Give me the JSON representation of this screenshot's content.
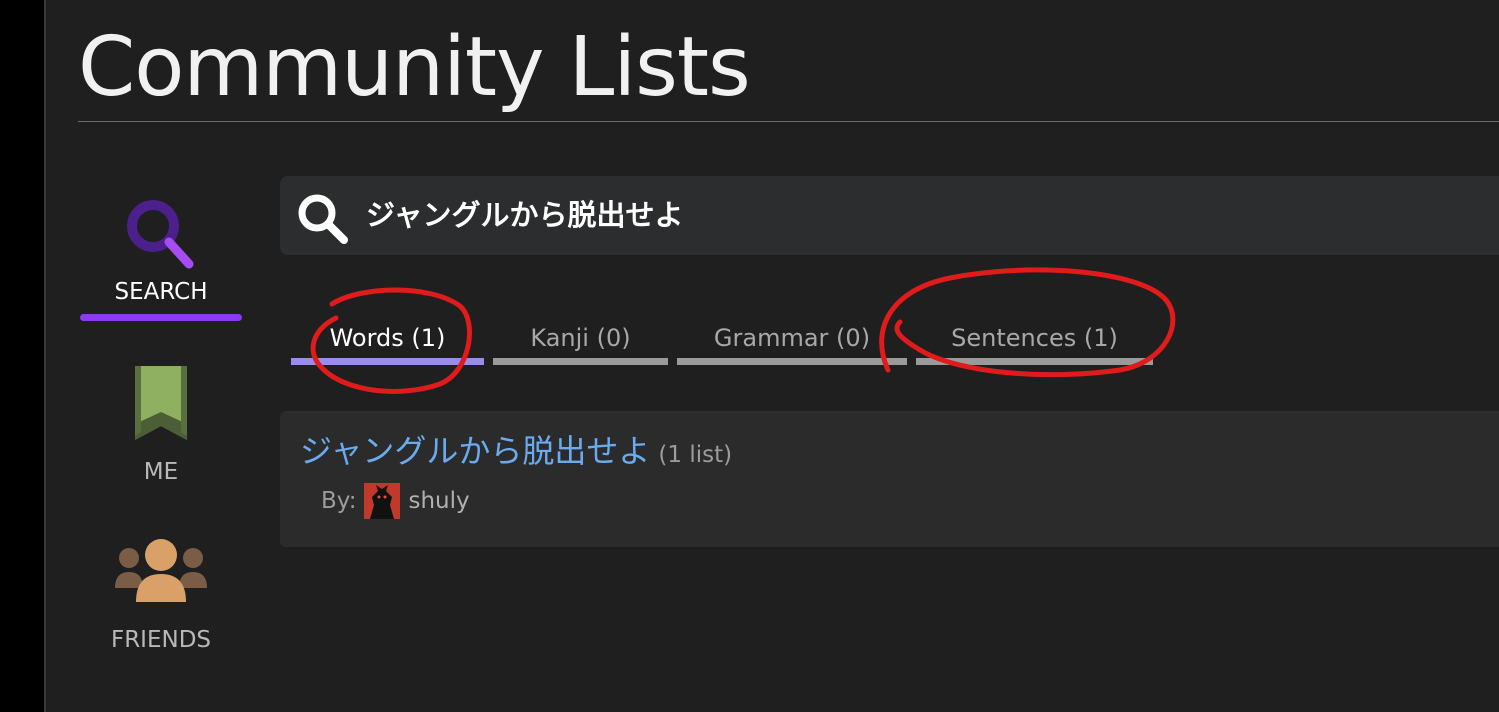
{
  "page": {
    "title": "Community Lists"
  },
  "nav": {
    "search_label": "SEARCH",
    "me_label": "ME",
    "friends_label": "FRIENDS"
  },
  "search": {
    "query": "ジャングルから脱出せよ"
  },
  "tabs": [
    {
      "label": "Words (1)",
      "active": true
    },
    {
      "label": "Kanji (0)",
      "active": false
    },
    {
      "label": "Grammar (0)",
      "active": false
    },
    {
      "label": "Sentences (1)",
      "active": false
    }
  ],
  "results": [
    {
      "title": "ジャングルから脱出せよ",
      "count": "(1 list)",
      "by_label": "By:",
      "author": "shuly"
    }
  ],
  "colors": {
    "background": "#1f1f1f",
    "search_accent": "#8e3bf0",
    "active_tab": "#9a8de8",
    "link": "#6aabf0",
    "annotation": "#e01b1b",
    "bookmark": "#8fb060",
    "friends": "#d9a168"
  },
  "icons": {
    "search": "search-icon",
    "me": "bookmark-icon",
    "friends": "friends-icon"
  }
}
